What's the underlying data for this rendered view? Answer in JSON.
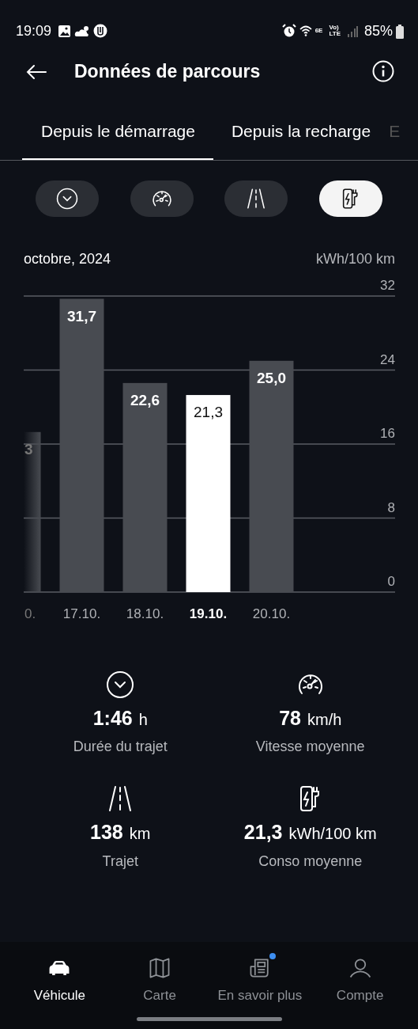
{
  "status_bar": {
    "time": "19:09",
    "wifi_label": "6E",
    "volte_labels": [
      "Vo)",
      "LTE"
    ],
    "battery": "85%"
  },
  "header": {
    "title": "Données de parcours"
  },
  "tabs": [
    {
      "label": "Depuis le démarrage",
      "selected": true
    },
    {
      "label": "Depuis la recharge",
      "selected": false
    },
    {
      "label": "E",
      "selected": false
    }
  ],
  "filters": [
    {
      "kind": "duration",
      "selected": false
    },
    {
      "kind": "speed",
      "selected": false
    },
    {
      "kind": "distance",
      "selected": false
    },
    {
      "kind": "consumption",
      "selected": true
    }
  ],
  "chart": {
    "period": "octobre, 2024",
    "unit": "kWh/100 km",
    "bar_selected": [
      false,
      false,
      false,
      true,
      false
    ],
    "cut_bar_label": "3",
    "chart_data": {
      "type": "bar",
      "categories": [
        "0.",
        "17.10.",
        "18.10.",
        "19.10.",
        "20.10."
      ],
      "values": [
        17.3,
        31.7,
        22.6,
        21.3,
        25.0
      ],
      "ylim": [
        0,
        32
      ],
      "yticks": [
        0,
        8,
        16,
        24,
        32
      ],
      "grid": true,
      "value_labels": [
        null,
        "31,7",
        "22,6",
        "21,3",
        "25,0"
      ]
    }
  },
  "stats": [
    {
      "kind": "duration",
      "value": "1:46",
      "unit": "h",
      "label": "Durée du trajet"
    },
    {
      "kind": "speed",
      "value": "78",
      "unit": "km/h",
      "label": "Vitesse moyenne"
    },
    {
      "kind": "distance",
      "value": "138",
      "unit": "km",
      "label": "Trajet"
    },
    {
      "kind": "consumption",
      "value": "21,3",
      "unit": "kWh/100 km",
      "label": "Conso moyenne"
    }
  ],
  "bottom_nav": [
    {
      "kind": "car",
      "label": "Véhicule",
      "selected": true,
      "notification": false
    },
    {
      "kind": "map",
      "label": "Carte",
      "selected": false,
      "notification": false
    },
    {
      "kind": "news",
      "label": "En savoir plus",
      "selected": false,
      "notification": true
    },
    {
      "kind": "person",
      "label": "Compte",
      "selected": false,
      "notification": false
    }
  ]
}
